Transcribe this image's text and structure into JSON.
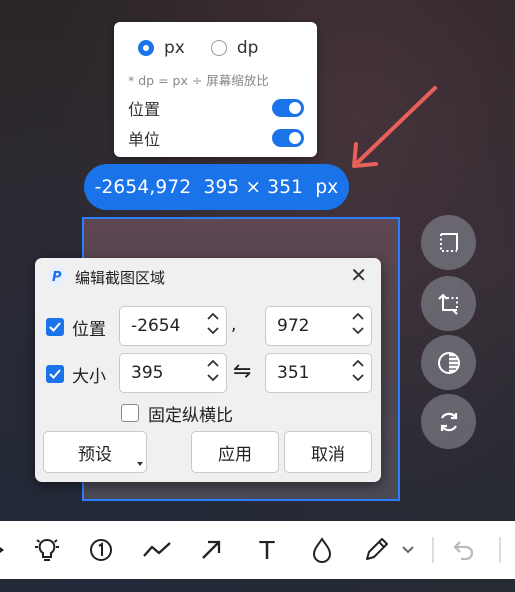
{
  "settings": {
    "unit_px": "px",
    "unit_dp": "dp",
    "hint": "* dp = px ÷ 屏幕缩放比",
    "position_label": "位置",
    "unit_label": "单位",
    "selected_unit": "px",
    "position_toggle": true,
    "unit_toggle": true
  },
  "info": {
    "text": "-2654,972  395 × 351  px"
  },
  "dialog": {
    "title": "编辑截图区域",
    "position_label": "位置",
    "position_checked": true,
    "x_value": "-2654",
    "separator": ",",
    "y_value": "972",
    "size_label": "大小",
    "size_checked": true,
    "width_value": "395",
    "height_value": "351",
    "swap_symbol": "⇋",
    "lock_ratio_label": "固定纵横比",
    "lock_ratio_checked": false,
    "preset_label": "预设",
    "apply_label": "应用",
    "cancel_label": "取消"
  },
  "side_tools": [
    "crop-icon",
    "flip-icon",
    "contrast-icon",
    "refresh-icon"
  ],
  "toolbar_tools": [
    "arrow-partial-icon",
    "bulb-icon",
    "number-marker-icon",
    "line-icon",
    "arrow-icon",
    "text-icon",
    "blur-drop-icon",
    "pen-icon",
    "undo-icon"
  ],
  "toolbar_text_tool": "T",
  "colors": {
    "accent": "#1a73e8",
    "annotation_arrow": "#e8605a"
  }
}
